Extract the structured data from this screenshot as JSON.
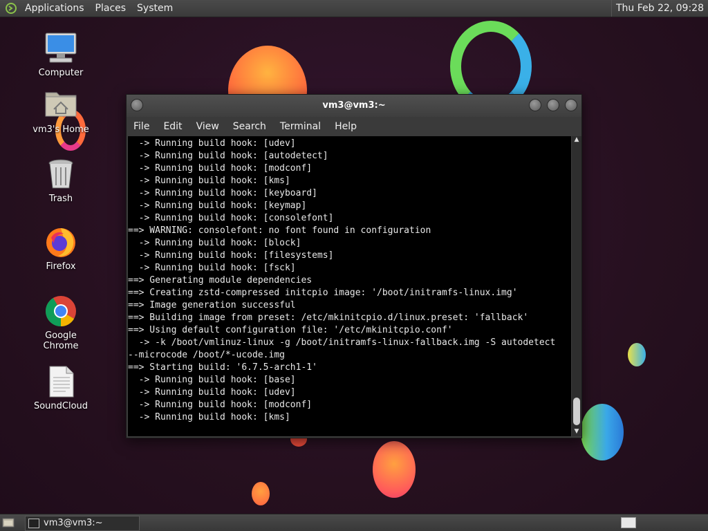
{
  "top_panel": {
    "menus": [
      "Applications",
      "Places",
      "System"
    ],
    "clock": "Thu Feb 22, 09:28"
  },
  "desktop_icons": [
    {
      "label": "Computer",
      "icon": "computer-icon"
    },
    {
      "label": "vm3's Home",
      "icon": "home-folder-icon"
    },
    {
      "label": "Trash",
      "icon": "trash-icon"
    },
    {
      "label": "Firefox",
      "icon": "firefox-icon"
    },
    {
      "label": "Google Chrome",
      "icon": "chrome-icon"
    },
    {
      "label": "SoundCloud",
      "icon": "document-icon"
    }
  ],
  "terminal": {
    "title": "vm3@vm3:~",
    "menu": [
      "File",
      "Edit",
      "View",
      "Search",
      "Terminal",
      "Help"
    ],
    "lines": [
      "  -> Running build hook: [udev]",
      "  -> Running build hook: [autodetect]",
      "  -> Running build hook: [modconf]",
      "  -> Running build hook: [kms]",
      "  -> Running build hook: [keyboard]",
      "  -> Running build hook: [keymap]",
      "  -> Running build hook: [consolefont]",
      "==> WARNING: consolefont: no font found in configuration",
      "  -> Running build hook: [block]",
      "  -> Running build hook: [filesystems]",
      "  -> Running build hook: [fsck]",
      "==> Generating module dependencies",
      "==> Creating zstd-compressed initcpio image: '/boot/initramfs-linux.img'",
      "==> Image generation successful",
      "==> Building image from preset: /etc/mkinitcpio.d/linux.preset: 'fallback'",
      "==> Using default configuration file: '/etc/mkinitcpio.conf'",
      "  -> -k /boot/vmlinuz-linux -g /boot/initramfs-linux-fallback.img -S autodetect",
      "--microcode /boot/*-ucode.img",
      "==> Starting build: '6.7.5-arch1-1'",
      "  -> Running build hook: [base]",
      "  -> Running build hook: [udev]",
      "  -> Running build hook: [modconf]",
      "  -> Running build hook: [kms]"
    ]
  },
  "taskbar": {
    "task_label": "vm3@vm3:~"
  },
  "colors": {
    "desktop_bg": "#26101f",
    "panel_bg": "#3f3f3f",
    "terminal_bg": "#000000",
    "terminal_fg": "#e8e8e8"
  }
}
